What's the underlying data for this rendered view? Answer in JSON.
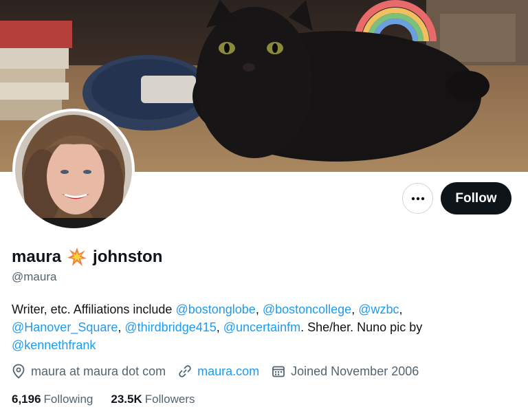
{
  "profile": {
    "name_first": "maura",
    "name_last": "johnston",
    "handle": "@maura",
    "follow_label": "Follow",
    "more_label": "•••"
  },
  "bio": {
    "t1": "Writer, etc. Affiliations include ",
    "m1": "@bostonglobe",
    "s1": ", ",
    "m2": "@bostoncollege",
    "s2": ", ",
    "m3": "@wzbc",
    "s3": ", ",
    "m4": "@Hanover_Square",
    "s4": ", ",
    "m5": "@thirdbridge415",
    "s5": ", ",
    "m6": "@uncertainfm",
    "t2": ". She/her. Nuno pic by ",
    "m7": "@kennethfrank"
  },
  "meta": {
    "location": "maura at maura dot com",
    "website": "maura.com",
    "joined": "Joined November 2006"
  },
  "stats": {
    "following_count": "6,196",
    "following_label": "Following",
    "followers_count": "23.5K",
    "followers_label": "Followers"
  },
  "colors": {
    "link": "#1d9bf0",
    "text": "#0f1419",
    "secondary": "#536471",
    "follow_bg": "#0f1419"
  },
  "icons": {
    "location": "map-pin-icon",
    "website": "link-icon",
    "joined": "calendar-icon",
    "emoji": "collision-emoji-icon",
    "more": "more-dots-icon"
  }
}
